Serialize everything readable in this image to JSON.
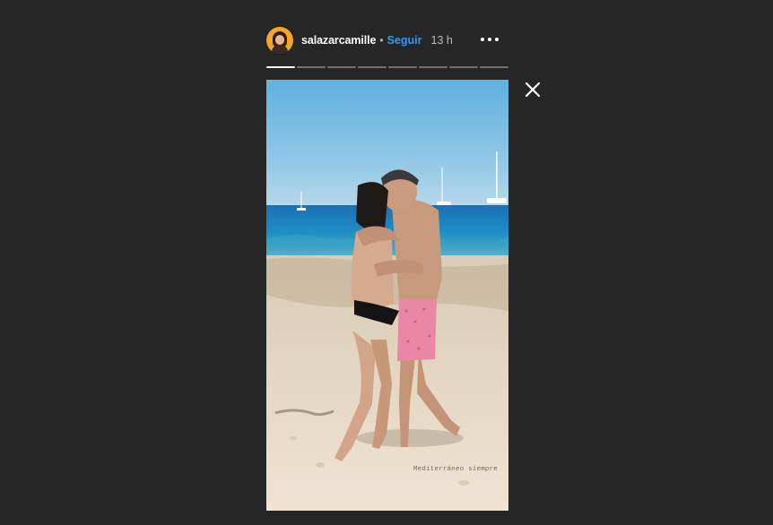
{
  "story": {
    "username": "salazarcamille",
    "separator": "•",
    "follow_label": "Seguir",
    "time_ago": "13 h",
    "progress": {
      "segments_total": 8,
      "segments_viewed": 1
    },
    "photo": {
      "subject": "couple-hugging-on-beach",
      "overlay_text": "Mediterráneo siempre"
    }
  },
  "icons": {
    "avatar": "profile-avatar",
    "more": "more-horizontal-icon",
    "close": "close-icon"
  },
  "colors": {
    "background": "#262626",
    "link": "#3897f0",
    "text": "#ffffff",
    "muted": "#bdbdbd"
  }
}
